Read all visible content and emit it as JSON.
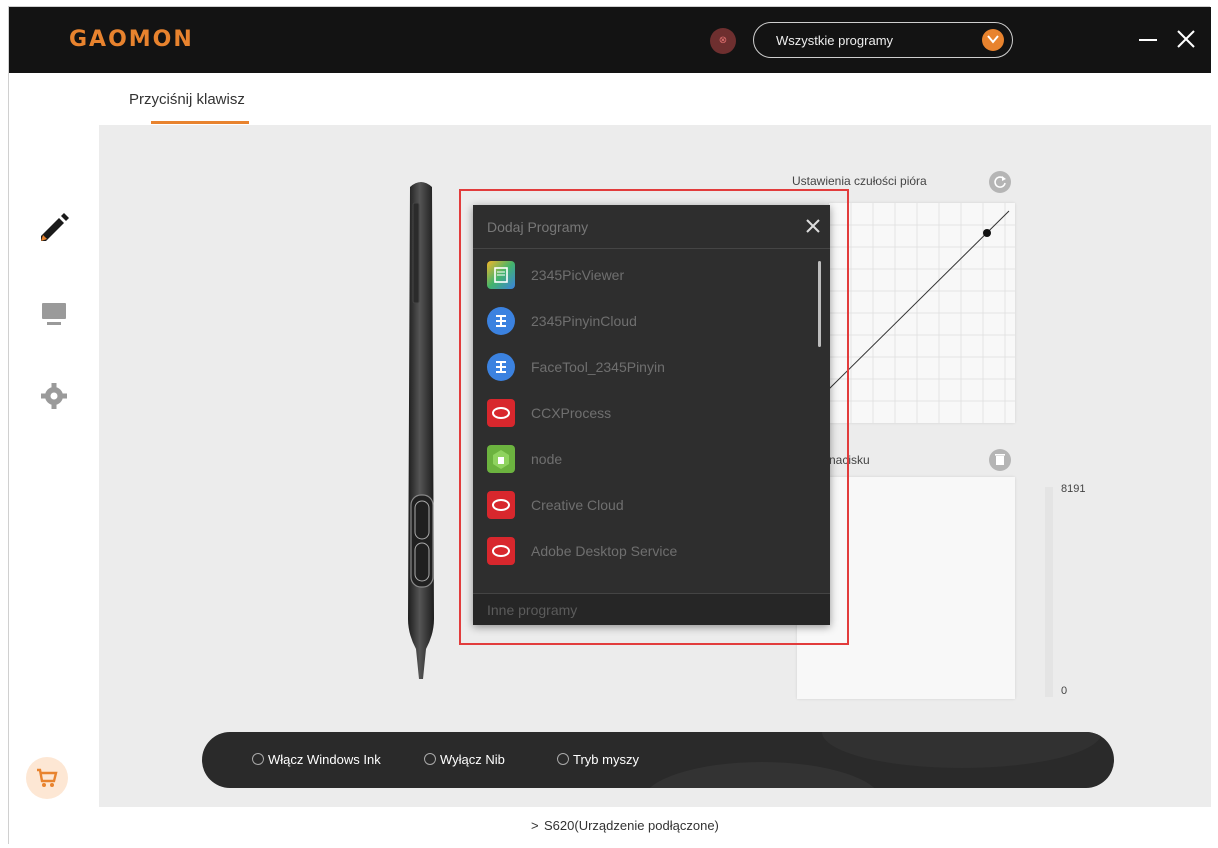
{
  "titlebar": {
    "logo": "GAOMON",
    "app_icon": "app-icon",
    "program_select": "Wszystkie programy"
  },
  "tabs": {
    "active": "Przyciśnij klawisz"
  },
  "sidebar": {
    "items": [
      "pen-icon",
      "monitor-icon",
      "gear-icon"
    ],
    "cart": "cart-icon"
  },
  "pen_panel": {
    "curve_title": "Ustawienia czułości pióra",
    "pressure_title": "nacisku",
    "pressure_max": "8191",
    "pressure_min": "0"
  },
  "popup": {
    "title": "Dodaj Programy",
    "items": [
      {
        "label": "2345PicViewer",
        "icon_color": "#f2b62a"
      },
      {
        "label": "2345PinyinCloud",
        "icon_color": "#3b82e0"
      },
      {
        "label": "FaceTool_2345Pinyin",
        "icon_color": "#3b82e0"
      },
      {
        "label": "CCXProcess",
        "icon_color": "#d8272d"
      },
      {
        "label": "node",
        "icon_color": "#6cb33f"
      },
      {
        "label": "Creative Cloud",
        "icon_color": "#d8272d"
      },
      {
        "label": "Adobe Desktop Service",
        "icon_color": "#d8272d"
      }
    ],
    "footer": "Inne programy"
  },
  "modebar": {
    "windows_ink": "Włącz Windows Ink",
    "disable_nib": "Wyłącz Nib",
    "mouse_mode": "Tryb myszy"
  },
  "statusbar": {
    "device": "S620(Urządzenie podłączone)"
  },
  "colors": {
    "accent": "#e8832e",
    "highlight": "#e23c3c"
  }
}
